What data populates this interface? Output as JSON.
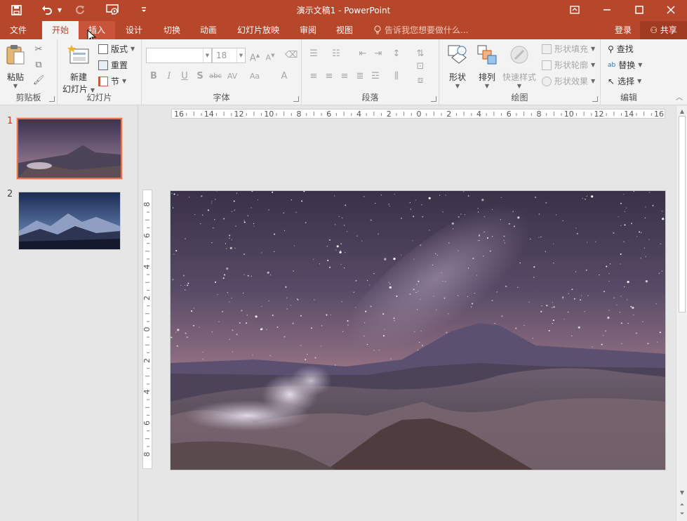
{
  "window": {
    "title": "演示文稿1 - PowerPoint",
    "controls": {
      "ribbon_display": "⧉",
      "minimize": "—",
      "maximize": "☐",
      "close": "✕"
    }
  },
  "quick_access": {
    "save_icon": "save-icon",
    "undo_icon": "undo-icon",
    "redo_icon": "redo-icon",
    "slideshow_icon": "from-beginning-icon",
    "customize_icon": "customize-qat-icon"
  },
  "tabs": [
    {
      "label": "文件"
    },
    {
      "label": "开始"
    },
    {
      "label": "插入"
    },
    {
      "label": "设计"
    },
    {
      "label": "切换"
    },
    {
      "label": "动画"
    },
    {
      "label": "幻灯片放映"
    },
    {
      "label": "审阅"
    },
    {
      "label": "视图"
    }
  ],
  "tell_me": "告诉我您想要做什么...",
  "account": {
    "login": "登录",
    "share": "共享"
  },
  "ribbon": {
    "clipboard": {
      "label": "剪贴板",
      "paste": "粘贴"
    },
    "slides": {
      "label": "幻灯片",
      "new_slide_line1": "新建",
      "new_slide_line2": "幻灯片",
      "layout": "版式",
      "reset": "重置",
      "section": "节"
    },
    "font": {
      "label": "字体",
      "font_name": "",
      "font_size": "18"
    },
    "paragraph": {
      "label": "段落"
    },
    "drawing": {
      "label": "绘图",
      "shapes": "形状",
      "arrange": "排列",
      "quick_styles": "快速样式",
      "shape_fill": "形状填充",
      "shape_outline": "形状轮廓",
      "shape_effects": "形状效果"
    },
    "editing": {
      "label": "编辑",
      "find": "查找",
      "replace": "替换",
      "select": "选择"
    }
  },
  "thumbnails": [
    {
      "number": "1"
    },
    {
      "number": "2"
    }
  ],
  "ruler": {
    "horizontal": [
      "16",
      "14",
      "12",
      "10",
      "8",
      "6",
      "4",
      "2",
      "0",
      "2",
      "4",
      "6",
      "8",
      "10",
      "12",
      "14",
      "16"
    ],
    "vertical": [
      "8",
      "6",
      "4",
      "2",
      "0",
      "2",
      "4",
      "6",
      "8"
    ]
  },
  "colors": {
    "accent": "#b7472a",
    "ribbon_bg": "#f3f3f3",
    "workspace_bg": "#e6e6e6",
    "selected_thumb_border": "#e07455"
  }
}
